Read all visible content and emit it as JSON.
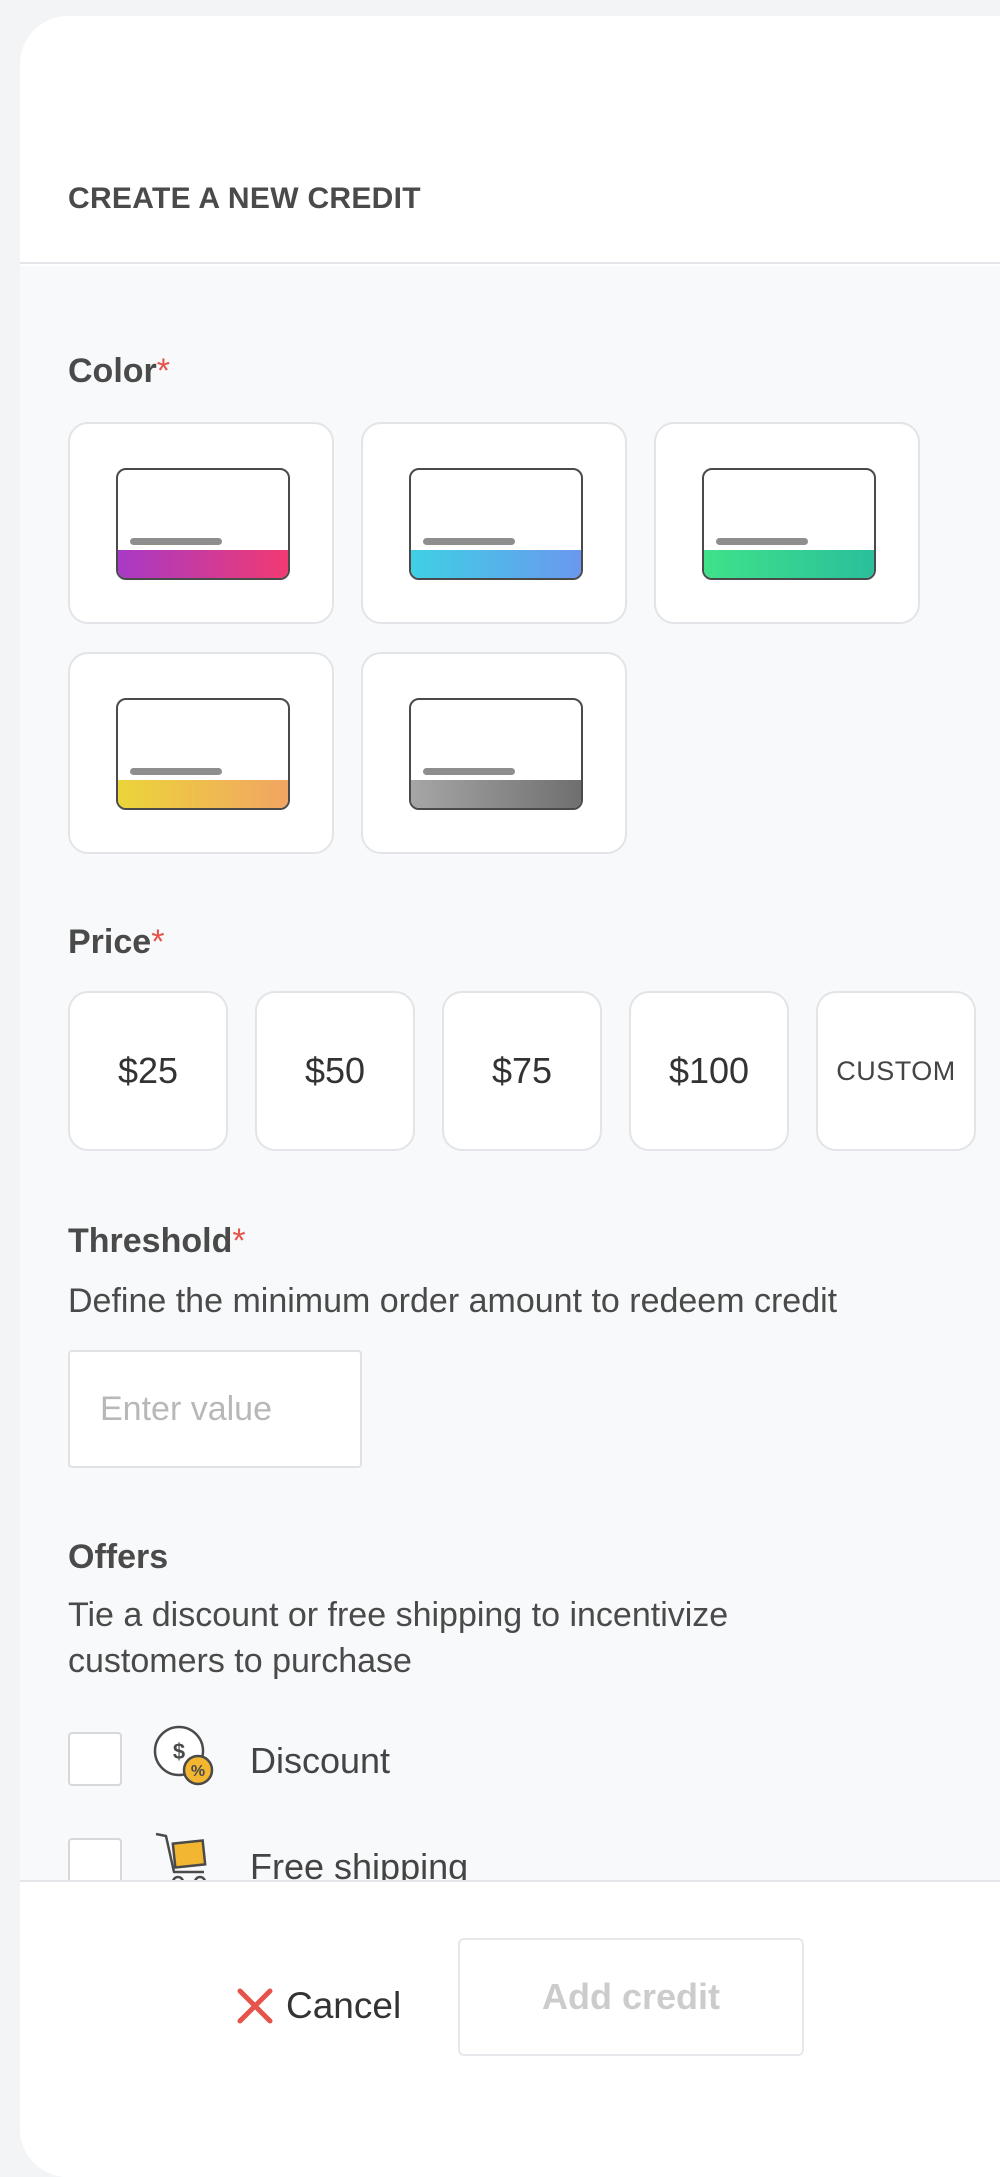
{
  "header": {
    "title": "CREATE A NEW CREDIT"
  },
  "color_section": {
    "label": "Color",
    "required_mark": "*",
    "swatches": [
      {
        "name": "magenta",
        "from": "#a73ac6",
        "to": "#f13a72"
      },
      {
        "name": "blue",
        "from": "#3fd0e4",
        "to": "#6a98ef"
      },
      {
        "name": "green",
        "from": "#3fe28a",
        "to": "#2abf9b"
      },
      {
        "name": "yellow",
        "from": "#ecd43a",
        "to": "#f1a562"
      },
      {
        "name": "gray",
        "from": "#a6a6a6",
        "to": "#6f6f6f"
      }
    ]
  },
  "price_section": {
    "label": "Price",
    "required_mark": "*",
    "options": [
      "$25",
      "$50",
      "$75",
      "$100",
      "CUSTOM"
    ]
  },
  "threshold_section": {
    "label": "Threshold",
    "required_mark": "*",
    "description": "Define the minimum order amount to redeem credit",
    "input": {
      "placeholder": "Enter value",
      "value": ""
    }
  },
  "offers_section": {
    "label": "Offers",
    "description": "Tie a discount or free shipping to incentivize customers to purchase",
    "options": [
      {
        "label": "Discount",
        "icon": "discount-icon",
        "checked": false
      },
      {
        "label": "Free shipping",
        "icon": "shipping-cart-icon",
        "checked": false
      }
    ]
  },
  "footer": {
    "cancel_label": "Cancel",
    "add_label": "Add credit"
  },
  "colors": {
    "required": "#e5534b",
    "cancel_icon": "#e5534b",
    "icon_accent": "#f2b630"
  }
}
